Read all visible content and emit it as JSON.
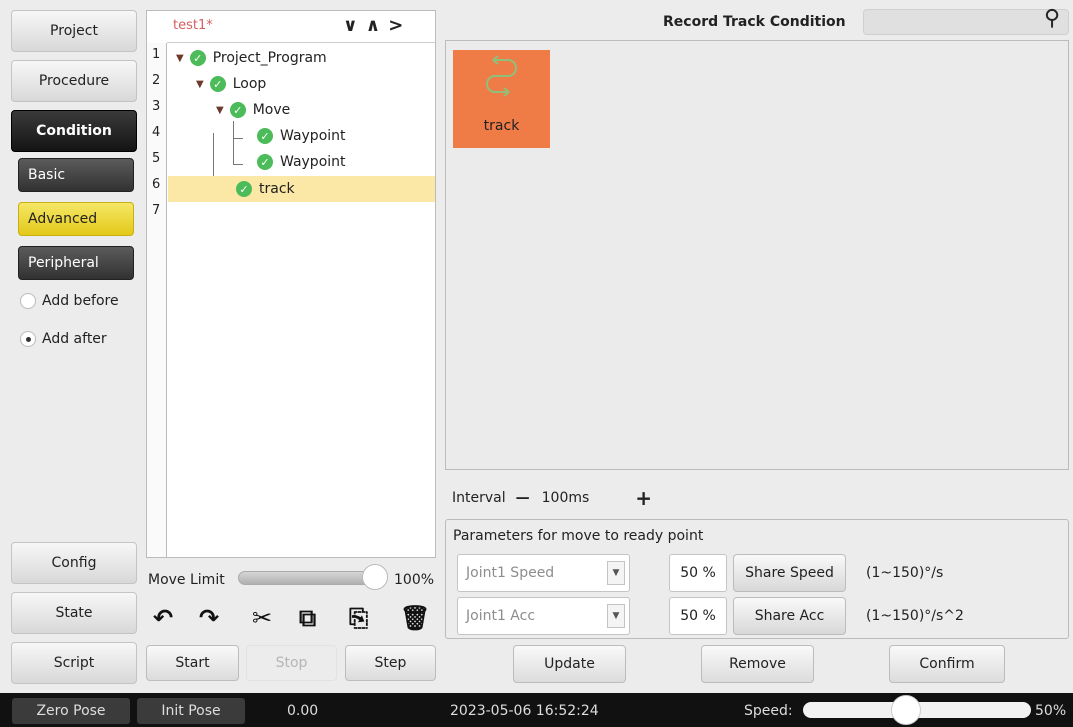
{
  "sidebar": {
    "project": "Project",
    "procedure": "Procedure",
    "condition": "Condition",
    "basic": "Basic",
    "advanced": "Advanced",
    "peripheral": "Peripheral",
    "add_before": "Add before",
    "add_after": "Add after",
    "selected_insert": "Add after",
    "config": "Config",
    "state": "State",
    "script": "Script"
  },
  "tree": {
    "title": "test1*",
    "nav": [
      "∨",
      "∧",
      ">"
    ],
    "line_numbers": [
      "1",
      "2",
      "3",
      "4",
      "5",
      "6",
      "7"
    ],
    "nodes": [
      {
        "label": "Project_Program"
      },
      {
        "label": "Loop"
      },
      {
        "label": "Move"
      },
      {
        "label": "Waypoint"
      },
      {
        "label": "Waypoint"
      },
      {
        "label": "track",
        "selected": true
      }
    ]
  },
  "move_limit": {
    "label": "Move Limit",
    "value": "100%",
    "level": 1.0
  },
  "toolbar_icons": [
    "undo-icon",
    "redo-icon",
    "cut-icon",
    "copy-icon",
    "paste-icon",
    "delete-icon"
  ],
  "run_buttons": {
    "start": "Start",
    "stop": "Stop",
    "step": "Step"
  },
  "record": {
    "title": "Record Track Condition",
    "search_placeholder": "",
    "tile_label": "track",
    "interval_label": "Interval",
    "interval_minus": "—",
    "interval_value": "100ms",
    "interval_plus": "+"
  },
  "params": {
    "title": "Parameters for move to ready point",
    "speed_select": "Joint1 Speed",
    "speed_pct": "50 %",
    "share_speed": "Share Speed",
    "speed_range": "(1~150)°/s",
    "acc_select": "Joint1 Acc",
    "acc_pct": "50 %",
    "share_acc": "Share Acc",
    "acc_range": "(1~150)°/s^2"
  },
  "actions": {
    "update": "Update",
    "remove": "Remove",
    "confirm": "Confirm"
  },
  "statusbar": {
    "zero_pose": "Zero Pose",
    "init_pose": "Init Pose",
    "value": "0.00",
    "datetime": "2023-05-06 16:52:24",
    "speed_label": "Speed:",
    "speed_value": "50%",
    "speed_level": 0.5
  },
  "colors": {
    "accent_yellow": "#e8d22a",
    "tile_orange": "#ef7b47",
    "check_green": "#4cbc5a",
    "selection": "#fbe7a6"
  }
}
